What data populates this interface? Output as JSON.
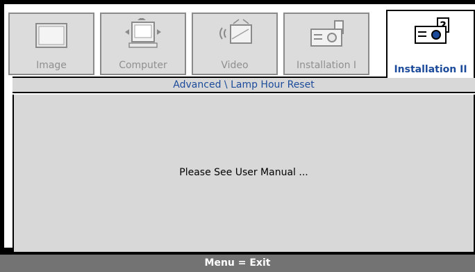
{
  "tabs": [
    {
      "label": "Image",
      "icon": "image-icon",
      "active": false
    },
    {
      "label": "Computer",
      "icon": "computer-icon",
      "active": false
    },
    {
      "label": "Video",
      "icon": "video-icon",
      "active": false
    },
    {
      "label": "Installation I",
      "icon": "projector-icon",
      "active": false
    },
    {
      "label": "Installation II",
      "icon": "projector-help-icon",
      "active": true
    }
  ],
  "breadcrumb": "Advanced \\ Lamp Hour Reset",
  "message": "Please See User Manual ...",
  "footer": "Menu = Exit",
  "colors": {
    "accent": "#1b4b9a",
    "panel": "#d8d8d8",
    "footer": "#737373",
    "frame": "#000000"
  }
}
